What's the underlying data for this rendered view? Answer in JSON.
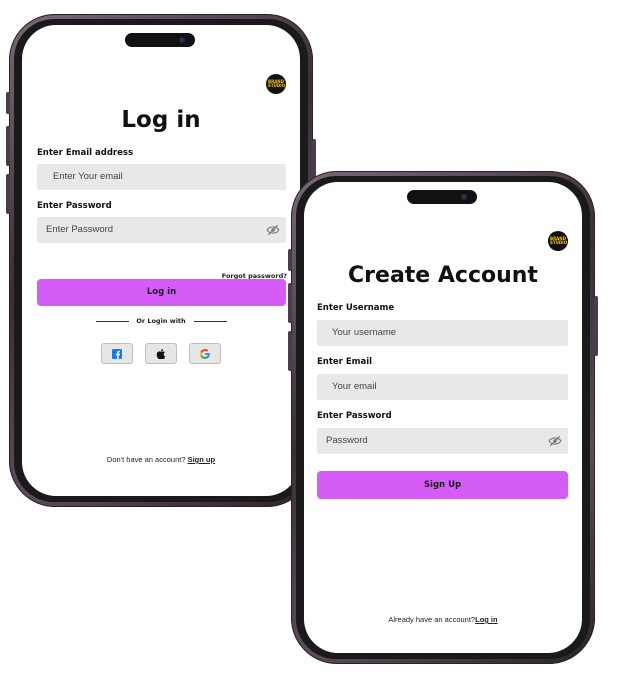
{
  "login": {
    "title": "Log in",
    "email_label": "Enter Email address",
    "email_placeholder": "Enter Your email",
    "password_label": "Enter Password",
    "password_placeholder": "Enter Password",
    "forgot_password": "Forgot  password?",
    "login_button": "Log in",
    "or_login_with": "Or Login with",
    "footer_text": "Don't have an account? ",
    "footer_link": "Sign up"
  },
  "signup": {
    "title": "Create Account",
    "username_label": "Enter Username",
    "username_placeholder": "Your username",
    "email_label": "Enter Email",
    "email_placeholder": "Your email",
    "password_label": "Enter Password",
    "password_placeholder": "Password",
    "signup_button": "Sign Up",
    "footer_text": "Already have an account?",
    "footer_link": "Log in"
  },
  "logo": {
    "line1": "BRAND",
    "line2": "STUDIO"
  },
  "colors": {
    "accent": "#d55cf7",
    "field_bg": "#e8e8e8",
    "frame": "#4a3c48"
  },
  "icons": [
    "eye-off-icon",
    "facebook-icon",
    "apple-icon",
    "google-icon"
  ]
}
